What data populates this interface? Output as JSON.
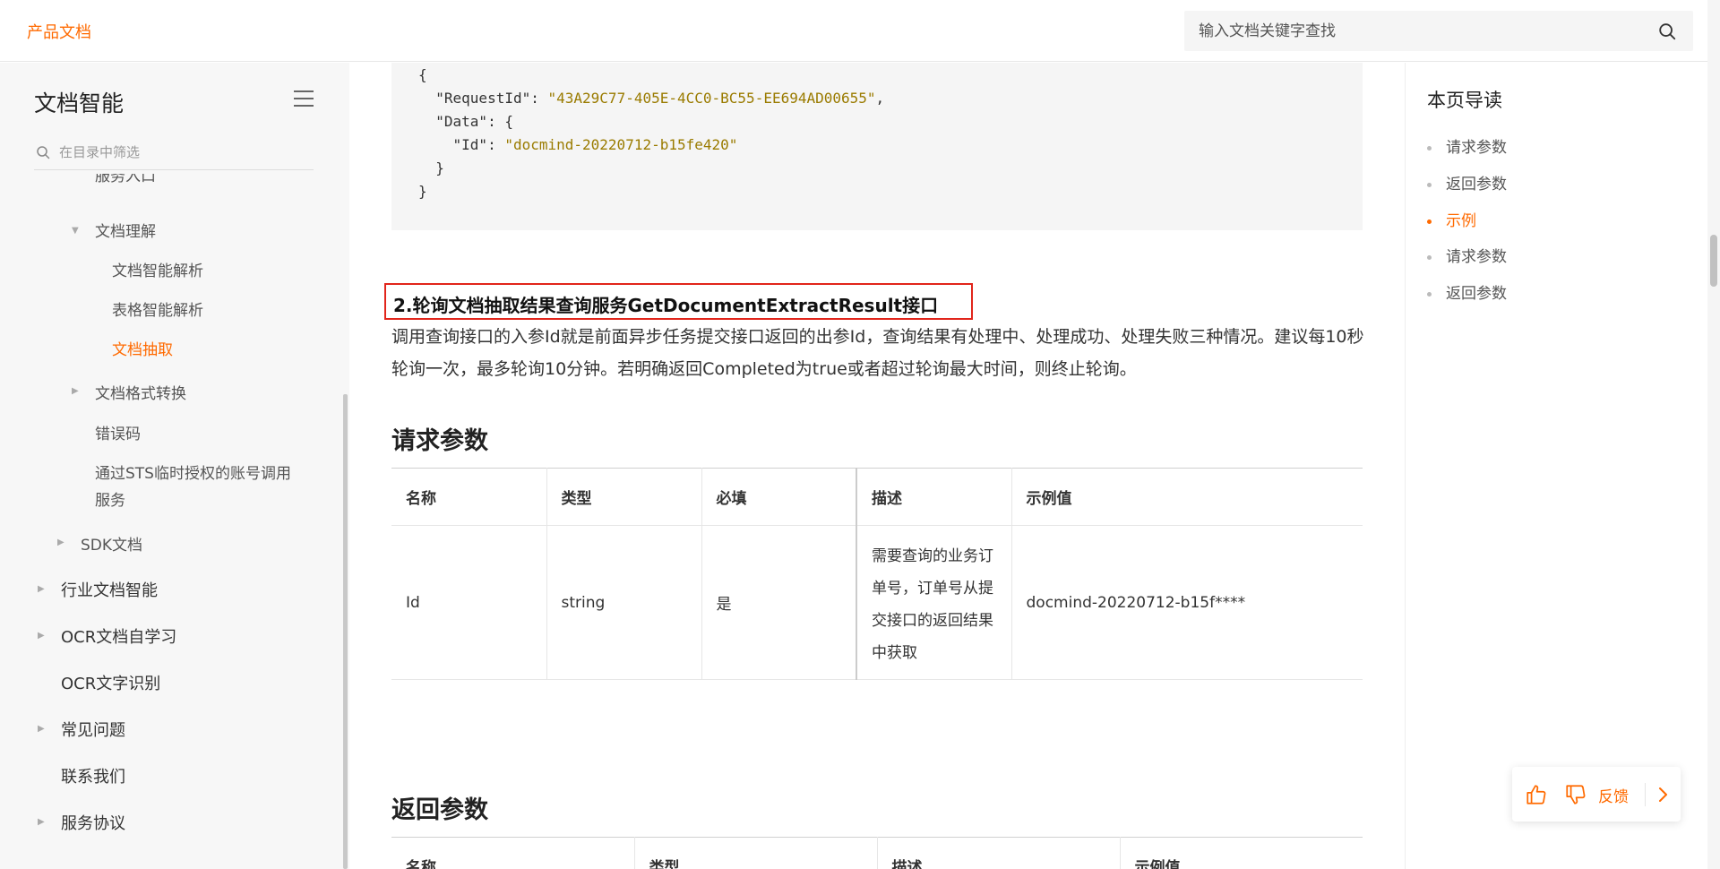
{
  "header": {
    "brand": "产品文档",
    "search_placeholder": "输入文档关键字查找"
  },
  "sidebar": {
    "title": "文档智能",
    "filter_placeholder": "在目录中筛选",
    "clipped_item": "服务入口",
    "items": [
      {
        "label": "文档理解"
      },
      {
        "label": "文档智能解析"
      },
      {
        "label": "表格智能解析"
      },
      {
        "label": "文档抽取"
      },
      {
        "label": "文档格式转换"
      },
      {
        "label": "错误码"
      },
      {
        "label": "通过STS临时授权的账号调用"
      },
      {
        "label": "服务"
      },
      {
        "label": "SDK文档"
      },
      {
        "label": "行业文档智能"
      },
      {
        "label": "OCR文档自学习"
      },
      {
        "label": "OCR文字识别"
      },
      {
        "label": "常见问题"
      },
      {
        "label": "联系我们"
      },
      {
        "label": "服务协议"
      }
    ]
  },
  "code": {
    "l1": "{",
    "l2_key": "  \"RequestId\": ",
    "l2_val": "\"43A29C77-405E-4CC0-BC55-EE694AD00655\"",
    "l2_tail": ",",
    "l3": "  \"Data\": {",
    "l4_key": "    \"Id\": ",
    "l4_val": "\"docmind-20220712-b15fe420\"",
    "l5": "  }",
    "l6": "}"
  },
  "content": {
    "section_heading": "2.轮询文档抽取结果查询服务GetDocumentExtractResult接口",
    "paragraph": "调用查询接口的入参Id就是前面异步任务提交接口返回的出参Id，查询结果有处理中、处理成功、处理失败三种情况。建议每10秒轮询一次，最多轮询10分钟。若明确返回Completed为true或者超过轮询最大时间，则终止轮询。",
    "request_heading": "请求参数",
    "response_heading": "返回参数",
    "table_headers": [
      "名称",
      "类型",
      "必填",
      "描述",
      "示例值"
    ],
    "table_row": {
      "name": "Id",
      "type": "string",
      "required": "是",
      "desc": "需要查询的业务订单号，订单号从提交接口的返回结果中获取",
      "example": "docmind-20220712-b15f****"
    },
    "response_headers": [
      "名称",
      "类型",
      "描述",
      "示例值"
    ]
  },
  "toc": {
    "title": "本页导读",
    "items": [
      "请求参数",
      "返回参数",
      "示例",
      "请求参数",
      "返回参数"
    ]
  },
  "feedback": {
    "label": "反馈"
  },
  "colors": {
    "accent": "#ff6a00",
    "highlight_border": "#e1251b"
  }
}
